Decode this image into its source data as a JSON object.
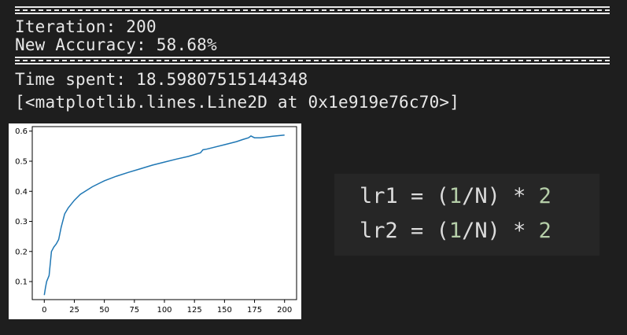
{
  "output": {
    "iteration_text": "Iteration: 200",
    "accuracy_text": "New Accuracy: 58.68%",
    "time_text": "Time spent: 18.59807515144348",
    "repr_text": "[<matplotlib.lines.Line2D at 0x1e919e76c70>]"
  },
  "code": {
    "line1": {
      "prefix": "lr1 = (",
      "one": "1",
      "mid": "/N) * ",
      "two": "2"
    },
    "line2": {
      "prefix": "lr2 = (",
      "one": "1",
      "mid": "/N) * ",
      "two": "2"
    }
  },
  "colors": {
    "background": "#1e1e1e",
    "text": "#e8e8e8",
    "line": "#1f77b4",
    "code_number": "#b5cea8"
  },
  "chart_data": {
    "type": "line",
    "title": "",
    "xlabel": "",
    "ylabel": "",
    "xlim": [
      -10,
      210
    ],
    "ylim": [
      0.04,
      0.615
    ],
    "xticks": [
      "0",
      "25",
      "50",
      "75",
      "100",
      "125",
      "150",
      "175",
      "200"
    ],
    "yticks": [
      "0.1",
      "0.2",
      "0.3",
      "0.4",
      "0.5",
      "0.6"
    ],
    "series": [
      {
        "x": [
          0,
          1,
          2,
          4,
          6,
          8,
          10,
          12,
          14,
          15,
          17,
          20,
          25,
          30,
          40,
          50,
          60,
          70,
          80,
          90,
          100,
          110,
          120,
          130,
          132,
          135,
          140,
          150,
          160,
          165,
          170,
          172,
          175,
          180,
          190,
          200
        ],
        "y": [
          0.055,
          0.08,
          0.1,
          0.12,
          0.2,
          0.215,
          0.225,
          0.24,
          0.28,
          0.295,
          0.325,
          0.345,
          0.37,
          0.39,
          0.415,
          0.435,
          0.45,
          0.463,
          0.475,
          0.487,
          0.497,
          0.507,
          0.516,
          0.528,
          0.538,
          0.54,
          0.545,
          0.555,
          0.565,
          0.572,
          0.578,
          0.584,
          0.578,
          0.578,
          0.583,
          0.587
        ]
      }
    ]
  }
}
